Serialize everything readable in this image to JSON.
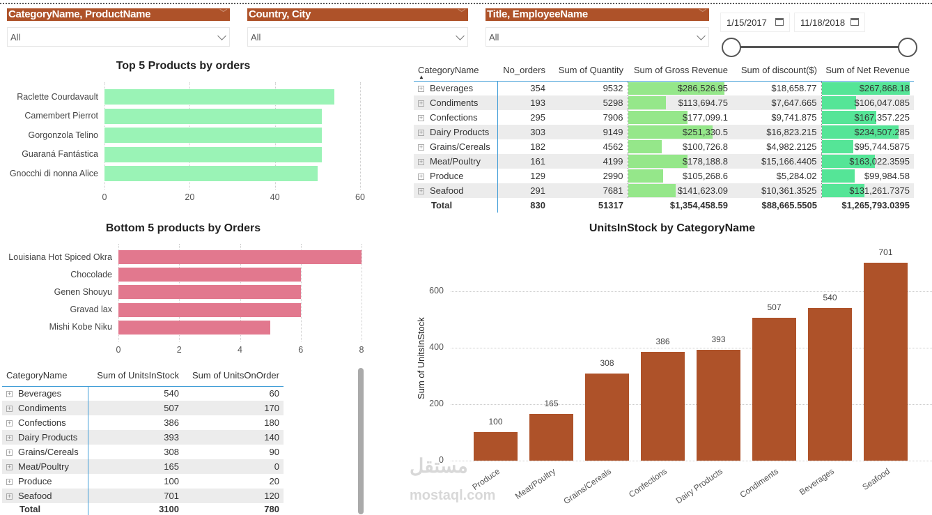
{
  "slicers": [
    {
      "title": "CategoryName, ProductName",
      "value": "All"
    },
    {
      "title": "Country, City",
      "value": "All"
    },
    {
      "title": "Title, EmployeeName",
      "value": "All"
    }
  ],
  "date_range": {
    "start": "1/15/2017",
    "end": "11/18/2018",
    "slider_start_fraction": 0,
    "slider_end_fraction": 1
  },
  "colors": {
    "accent": "#AE5229",
    "top_bar": "#9AF3B6",
    "bottom_bar": "#E2788E",
    "gross_bar": "#95E78A",
    "net_bar": "#55E597",
    "column_bar": "#AE5229"
  },
  "top_chart_data": {
    "type": "bar",
    "title": "Top 5 Products by orders",
    "categories": [
      "Raclette Courdavault",
      "Camembert Pierrot",
      "Gorgonzola Telino",
      "Guaraná Fantástica",
      "Gnocchi di nonna Alice"
    ],
    "values": [
      54,
      51,
      51,
      51,
      50
    ],
    "xlim": [
      0,
      60
    ],
    "ticks": [
      "0",
      "20",
      "40",
      "60"
    ]
  },
  "bottom_chart_data": {
    "type": "bar",
    "title": "Bottom 5 products by Orders",
    "categories": [
      "Louisiana Hot Spiced Okra",
      "Chocolade",
      "Genen Shouyu",
      "Gravad lax",
      "Mishi Kobe Niku"
    ],
    "values": [
      8,
      6,
      6,
      6,
      5
    ],
    "xlim": [
      0,
      8
    ],
    "ticks": [
      "0",
      "2",
      "4",
      "6",
      "8"
    ]
  },
  "chart_data": {
    "type": "bar",
    "title": "UnitsInStock by CategoryName",
    "xlabel": "",
    "ylabel": "Sum of UnitsInStock",
    "categories": [
      "Produce",
      "Meat/Poultry",
      "Grains/Cereals",
      "Confections",
      "Dairy Products",
      "Condiments",
      "Beverages",
      "Seafood"
    ],
    "values": [
      100,
      165,
      308,
      386,
      393,
      507,
      540,
      701
    ],
    "data_labels": [
      "100",
      "165",
      "308",
      "386",
      "393",
      "507",
      "540",
      "701"
    ],
    "ylim": [
      0,
      701
    ],
    "yticks": [
      "0",
      "200",
      "400",
      "600"
    ],
    "grid": true
  },
  "sales_table": {
    "headers": [
      "CategoryName",
      "No_orders",
      "Sum of Quantity",
      "Sum of Gross Revenue",
      "Sum of discount($)",
      "Sum of Net Revenue"
    ],
    "rows": [
      {
        "cat": "Beverages",
        "orders": "354",
        "qty": "9532",
        "gross": "$286,526.95",
        "disc": "$18,658.77",
        "net": "$267,868.18",
        "gross_v": 286526.95,
        "net_v": 267868.18
      },
      {
        "cat": "Condiments",
        "orders": "193",
        "qty": "5298",
        "gross": "$113,694.75",
        "disc": "$7,647.665",
        "net": "$106,047.085",
        "gross_v": 113694.75,
        "net_v": 106047.085
      },
      {
        "cat": "Confections",
        "orders": "295",
        "qty": "7906",
        "gross": "$177,099.1",
        "disc": "$9,741.875",
        "net": "$167,357.225",
        "gross_v": 177099.1,
        "net_v": 167357.225
      },
      {
        "cat": "Dairy Products",
        "orders": "303",
        "qty": "9149",
        "gross": "$251,330.5",
        "disc": "$16,823.215",
        "net": "$234,507.285",
        "gross_v": 251330.5,
        "net_v": 234507.285
      },
      {
        "cat": "Grains/Cereals",
        "orders": "182",
        "qty": "4562",
        "gross": "$100,726.8",
        "disc": "$4,982.2125",
        "net": "$95,744.5875",
        "gross_v": 100726.8,
        "net_v": 95744.5875
      },
      {
        "cat": "Meat/Poultry",
        "orders": "161",
        "qty": "4199",
        "gross": "$178,188.8",
        "disc": "$15,166.4405",
        "net": "$163,022.3595",
        "gross_v": 178188.8,
        "net_v": 163022.3595
      },
      {
        "cat": "Produce",
        "orders": "129",
        "qty": "2990",
        "gross": "$105,268.6",
        "disc": "$5,284.02",
        "net": "$99,984.58",
        "gross_v": 105268.6,
        "net_v": 99984.58
      },
      {
        "cat": "Seafood",
        "orders": "291",
        "qty": "7681",
        "gross": "$141,623.09",
        "disc": "$10,361.3525",
        "net": "$131,261.7375",
        "gross_v": 141623.09,
        "net_v": 131261.7375
      }
    ],
    "total": {
      "cat": "Total",
      "orders": "830",
      "qty": "51317",
      "gross": "$1,354,458.59",
      "disc": "$88,665.5505",
      "net": "$1,265,793.0395"
    }
  },
  "stock_table": {
    "headers": [
      "CategoryName",
      "Sum of UnitsInStock",
      "Sum of UnitsOnOrder"
    ],
    "rows": [
      {
        "cat": "Beverages",
        "stock": "540",
        "order": "60"
      },
      {
        "cat": "Condiments",
        "stock": "507",
        "order": "170"
      },
      {
        "cat": "Confections",
        "stock": "386",
        "order": "180"
      },
      {
        "cat": "Dairy Products",
        "stock": "393",
        "order": "140"
      },
      {
        "cat": "Grains/Cereals",
        "stock": "308",
        "order": "90"
      },
      {
        "cat": "Meat/Poultry",
        "stock": "165",
        "order": "0"
      },
      {
        "cat": "Produce",
        "stock": "100",
        "order": "20"
      },
      {
        "cat": "Seafood",
        "stock": "701",
        "order": "120"
      }
    ],
    "total": {
      "cat": "Total",
      "stock": "3100",
      "order": "780"
    }
  },
  "watermark": {
    "arabic": "مستقل",
    "latin": "mostaql.com"
  }
}
